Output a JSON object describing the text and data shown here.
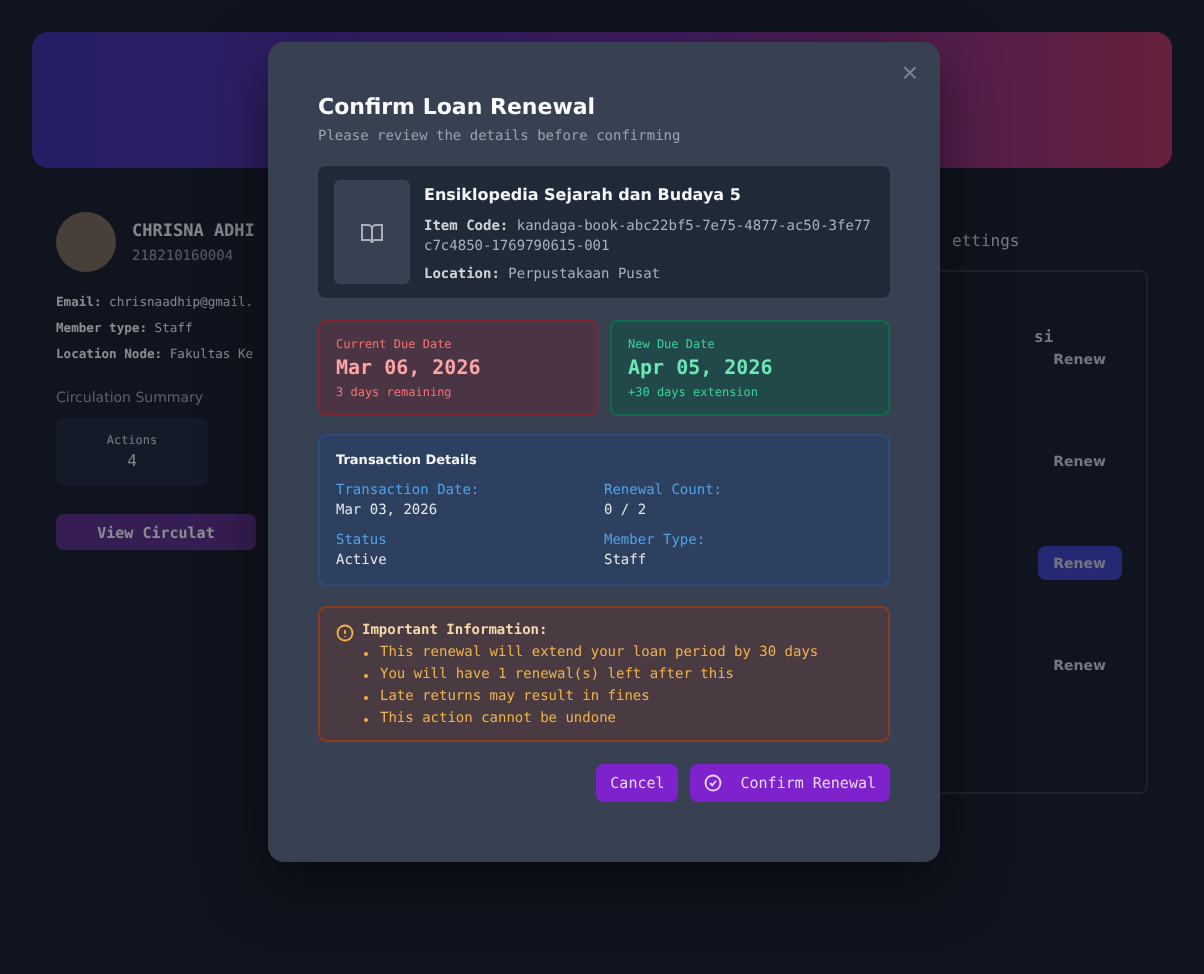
{
  "background": {
    "profile": {
      "name": "CHRISNA ADHI",
      "member_id": "218210160004",
      "fields": [
        {
          "label": "Email:",
          "value": "chrisnaadhip@gmail."
        },
        {
          "label": "Member type:",
          "value": "Staff"
        },
        {
          "label": "Location Node:",
          "value": "Fakultas Ke"
        }
      ],
      "summary_title": "Circulation Summary",
      "stats": [
        {
          "label": "Actions",
          "value": "4"
        }
      ],
      "action_button": "View Circulat"
    },
    "tab_label": "ettings",
    "item_title": "si",
    "renew_buttons": [
      {
        "label": "Renew",
        "highlighted": false
      },
      {
        "label": "Renew",
        "highlighted": false
      },
      {
        "label": "Renew",
        "highlighted": true
      },
      {
        "label": "Renew",
        "highlighted": false
      }
    ]
  },
  "dialog": {
    "title": "Confirm Loan Renewal",
    "subtitle": "Please review the details before confirming",
    "close": "×",
    "book": {
      "title": "Ensiklopedia Sejarah dan Budaya 5",
      "lines": [
        {
          "label": "Item Code:",
          "value": "kandaga-book-abc22bf5-7e75-4877-ac50-3fe77c7c4850-1769790615-001"
        },
        {
          "label": "Location:",
          "value": "Perpustakaan Pusat"
        }
      ]
    },
    "dates": [
      {
        "kind": "current",
        "label": "Current Due Date",
        "date": "Mar 06, 2026",
        "note": "3 days remaining"
      },
      {
        "kind": "new",
        "label": "New Due Date",
        "date": "Apr 05, 2026",
        "note": "+30 days extension"
      }
    ],
    "transaction": {
      "title": "Transaction Details",
      "fields": [
        {
          "label": "Transaction Date:",
          "value": "Mar 03, 2026"
        },
        {
          "label": "Renewal Count:",
          "value": "0 / 2"
        },
        {
          "label": "Status",
          "value": "Active"
        },
        {
          "label": "Member Type:",
          "value": "Staff"
        }
      ]
    },
    "info": {
      "title": "Important Information:",
      "items": [
        "This renewal will extend your loan period by 30 days",
        "You will have 1 renewal(s) left after this",
        "Late returns may result in fines",
        "This action cannot be undone"
      ]
    },
    "buttons": [
      {
        "kind": "cancel",
        "label": "Cancel"
      },
      {
        "kind": "confirm",
        "label": "Confirm Renewal"
      }
    ]
  }
}
